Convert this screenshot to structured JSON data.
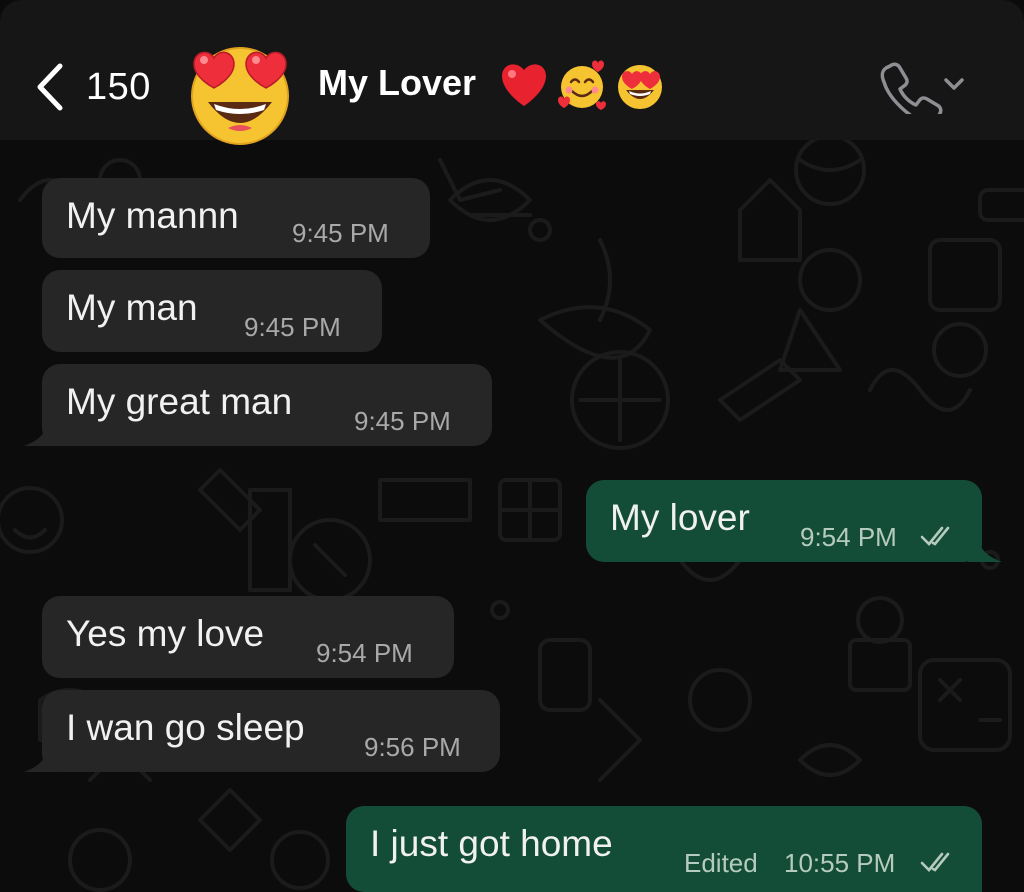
{
  "header": {
    "back_count": "150",
    "contact_name": "My Lover",
    "emojis": [
      "red-heart",
      "smiling-face-with-hearts",
      "heart-eyes-face"
    ],
    "avatar_icon": "heart-eyes-face",
    "call_icon": "phone-icon"
  },
  "messages": [
    {
      "direction": "incoming",
      "text": "My mannn",
      "time": "9:45 PM"
    },
    {
      "direction": "incoming",
      "text": "My man",
      "time": "9:45 PM"
    },
    {
      "direction": "incoming",
      "text": "My great man",
      "time": "9:45 PM"
    },
    {
      "direction": "outgoing",
      "text": "My lover",
      "time": "9:54 PM",
      "status": "read"
    },
    {
      "direction": "incoming",
      "text": "Yes my love",
      "time": "9:54 PM"
    },
    {
      "direction": "incoming",
      "text": "I wan go sleep",
      "time": "9:56 PM"
    },
    {
      "direction": "outgoing",
      "text": "I just got home",
      "edited_label": "Edited",
      "time": "10:55 PM",
      "status": "read"
    }
  ],
  "colors": {
    "incoming_bubble": "#262626",
    "outgoing_bubble": "#144d37",
    "header_bg": "#161616",
    "chat_bg": "#0c0c0c"
  }
}
